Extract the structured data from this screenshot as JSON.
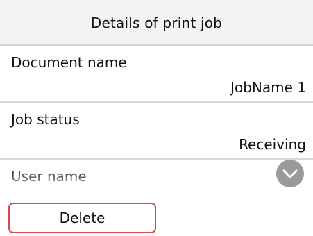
{
  "header": {
    "title": "Details of print job"
  },
  "details": [
    {
      "label": "Document name",
      "value": "JobName 1"
    },
    {
      "label": "Job status",
      "value": "Receiving"
    },
    {
      "label": "User name"
    }
  ],
  "controls": {
    "scroll_down_icon": "chevron-down-icon",
    "delete_label": "Delete"
  },
  "colors": {
    "title_bar": "#f3f3f3",
    "delete_border": "#d24a4a",
    "scroll_button": "#9a9a9a"
  }
}
